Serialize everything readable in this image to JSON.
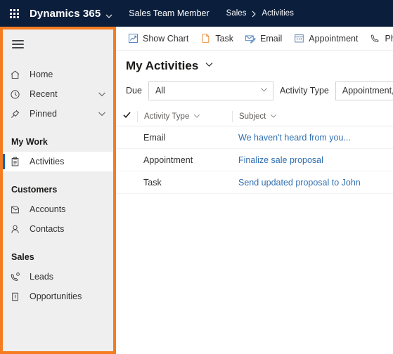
{
  "topbar": {
    "waffle_icon": "app-launcher-waffle-icon",
    "brand": "Dynamics 365",
    "brand_chevron_icon": "chevron-down-icon",
    "app_name": "Sales Team Member",
    "breadcrumb": {
      "items": [
        "Sales",
        "Activities"
      ],
      "separator_icon": "chevron-right-icon"
    }
  },
  "sidebar": {
    "highlight_color": "#f57c20",
    "selected_indicator_color": "#0b66c3",
    "hamburger_icon": "hamburger-menu-icon",
    "nav": [
      {
        "label": "Home",
        "icon": "home-icon",
        "expandable": false,
        "selected": false
      },
      {
        "label": "Recent",
        "icon": "clock-icon",
        "expandable": true,
        "selected": false
      },
      {
        "label": "Pinned",
        "icon": "pin-icon",
        "expandable": true,
        "selected": false
      }
    ],
    "groups": [
      {
        "title": "My Work",
        "items": [
          {
            "label": "Activities",
            "icon": "clipboard-icon",
            "selected": true
          }
        ]
      },
      {
        "title": "Customers",
        "items": [
          {
            "label": "Accounts",
            "icon": "building-icon",
            "selected": false
          },
          {
            "label": "Contacts",
            "icon": "person-icon",
            "selected": false
          }
        ]
      },
      {
        "title": "Sales",
        "items": [
          {
            "label": "Leads",
            "icon": "lead-phone-icon",
            "selected": false
          },
          {
            "label": "Opportunities",
            "icon": "opportunity-icon",
            "selected": false
          }
        ]
      }
    ]
  },
  "commandbar": {
    "items": [
      {
        "label": "Show Chart",
        "icon": "show-chart-icon"
      },
      {
        "label": "Task",
        "icon": "task-document-icon"
      },
      {
        "label": "Email",
        "icon": "email-envelope-icon"
      },
      {
        "label": "Appointment",
        "icon": "calendar-icon"
      },
      {
        "label": "Phone Call",
        "icon": "phone-icon"
      }
    ]
  },
  "view": {
    "title": "My Activities",
    "title_chevron_icon": "chevron-down-icon"
  },
  "filters": [
    {
      "label": "Due",
      "value": "All",
      "chevron_icon": "chevron-down-icon",
      "name": "due"
    },
    {
      "label": "Activity Type",
      "value": "Appointment,C",
      "chevron_icon": "chevron-down-icon",
      "name": "activity-type"
    }
  ],
  "grid": {
    "select_all_icon": "checkmark-icon",
    "columns": [
      {
        "label": "Activity Type",
        "sort_icon": "chevron-down-icon"
      },
      {
        "label": "Subject",
        "sort_icon": "chevron-down-icon"
      }
    ],
    "rows": [
      {
        "activity_type": "Email",
        "subject": "We haven't heard from you..."
      },
      {
        "activity_type": "Appointment",
        "subject": "Finalize sale proposal"
      },
      {
        "activity_type": "Task",
        "subject": "Send updated proposal to John"
      }
    ]
  }
}
